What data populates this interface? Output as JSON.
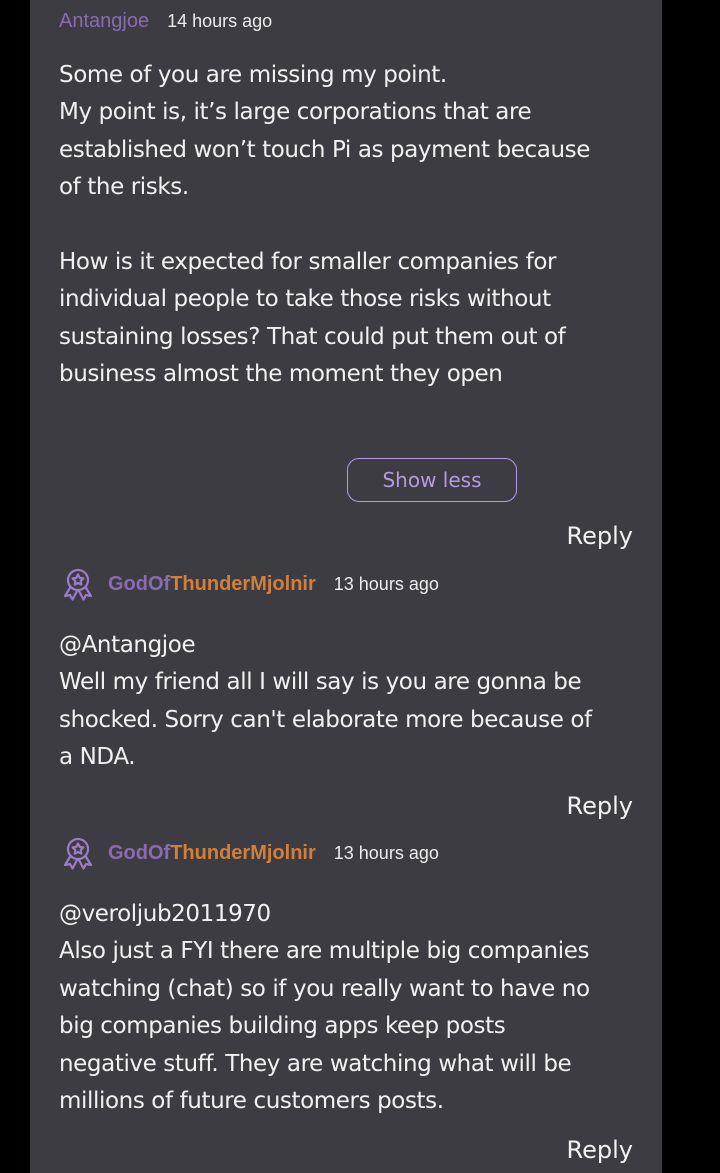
{
  "comments": [
    {
      "username": "Antangjoe",
      "time": "14 hours ago",
      "body": "Some of you are missing my point.\nMy point is, it’s large corporations that are\nestablished won’t touch Pi as payment because\nof the risks.\n\nHow is it expected for smaller companies for\nindividual people to take those risks without\nsustaining losses? That could put them out of\nbusiness almost the moment they open",
      "show_less_label": "Show less",
      "reply_label": "Reply"
    },
    {
      "badge_icon": "award-ribbon-icon",
      "username_prefix": "GodOf",
      "username_suffix": "ThunderMjolnir",
      "time": "13 hours ago",
      "body": "@Antangjoe\nWell my friend all I will say is you are gonna be\nshocked. Sorry can't elaborate more because of\na NDA.",
      "reply_label": "Reply"
    },
    {
      "badge_icon": "award-ribbon-icon",
      "username_prefix": "GodOf",
      "username_suffix": "ThunderMjolnir",
      "time": "13 hours ago",
      "body": "@veroljub2011970\nAlso just a FYI there are multiple big companies\nwatching (chat) so if you really want to have no\nbig companies building apps keep posts\nnegative stuff. They are watching what will be\nmillions of future customers posts.",
      "reply_label": "Reply"
    }
  ],
  "colors": {
    "background": "#000000",
    "card": "#3d3c42",
    "username_purple": "#8a6bb2",
    "username_orange": "#d27f3a",
    "accent": "#b49be0",
    "text": "#f1f1f1"
  }
}
